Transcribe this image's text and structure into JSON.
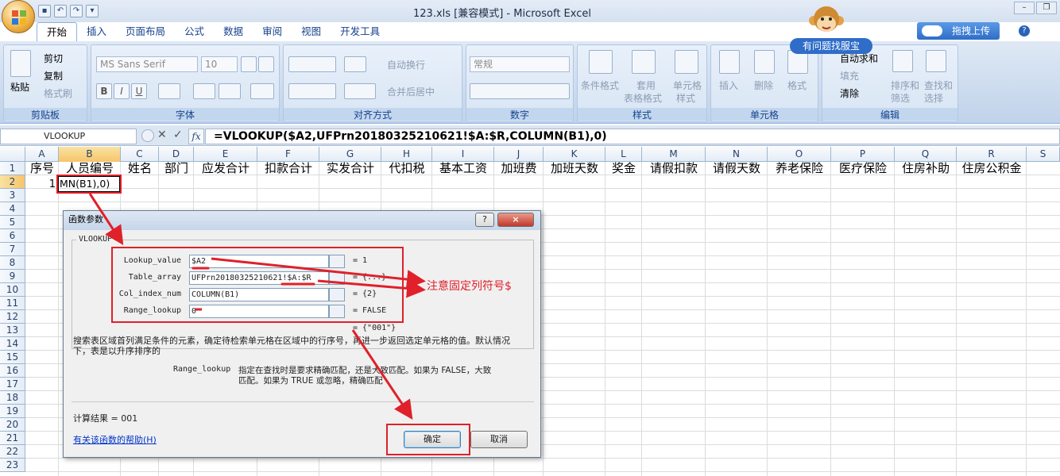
{
  "app": {
    "window_title": "123.xls  [兼容模式] - Microsoft Excel",
    "tabs": [
      "开始",
      "插入",
      "页面布局",
      "公式",
      "数据",
      "审阅",
      "视图",
      "开发工具"
    ],
    "assistant_badge": "有问题找服宝",
    "upload_button": "拖拽上传"
  },
  "ribbon": {
    "clipboard": {
      "paste": "粘贴",
      "cut": "剪切",
      "copy": "复制",
      "format_painter": "格式刷",
      "name": "剪贴板"
    },
    "font": {
      "family": "MS Sans Serif",
      "size": "10",
      "name": "字体"
    },
    "alignment": {
      "wrap": "自动换行",
      "merge": "合并后居中",
      "name": "对齐方式"
    },
    "number": {
      "format": "常规",
      "name": "数字"
    },
    "styles": {
      "conditional": "条件格式",
      "table_1": "套用",
      "table_2": "表格格式",
      "cell_1": "单元格",
      "cell_2": "样式",
      "name": "样式"
    },
    "cells": {
      "insert": "插入",
      "delete": "删除",
      "format": "格式",
      "name": "单元格"
    },
    "editing": {
      "autosum": "自动求和",
      "fill": "填充",
      "clear": "清除",
      "sort_1": "排序和",
      "sort_2": "筛选",
      "find_1": "查找和",
      "find_2": "选择",
      "name": "编辑"
    }
  },
  "formula_bar": {
    "name_box": "VLOOKUP",
    "fx": "fx",
    "formula": "=VLOOKUP($A2,UFPrn20180325210621!$A:$R,COLUMN(B1),0)"
  },
  "grid": {
    "columns": [
      "A",
      "B",
      "C",
      "D",
      "E",
      "F",
      "G",
      "H",
      "I",
      "J",
      "K",
      "L",
      "M",
      "N",
      "O",
      "P",
      "Q",
      "R",
      "S"
    ],
    "rows": [
      "1",
      "2",
      "3",
      "4",
      "5",
      "6",
      "7",
      "8",
      "9",
      "10",
      "11",
      "12",
      "13",
      "14",
      "15",
      "16",
      "17",
      "18",
      "19",
      "20",
      "21",
      "22",
      "23"
    ],
    "row1": [
      "序号",
      "人员编号",
      "姓名",
      "部门",
      "应发合计",
      "扣款合计",
      "实发合计",
      "代扣税",
      "基本工资",
      "加班费",
      "加班天数",
      "奖金",
      "请假扣款",
      "请假天数",
      "养老保险",
      "医疗保险",
      "住房补助",
      "住房公积金"
    ],
    "a2": "1",
    "b2": "MN(B1),0)"
  },
  "dialog": {
    "title": "函数参数",
    "help_q": "?",
    "close": "×",
    "function_name": "VLOOKUP",
    "args": [
      {
        "label": "Lookup_value",
        "value": "$A2",
        "result": "= 1"
      },
      {
        "label": "Table_array",
        "value": "UFPrn20180325210621!$A:$R",
        "result": "= {...}"
      },
      {
        "label": "Col_index_num",
        "value": "COLUMN(B1)",
        "result": "= {2}"
      },
      {
        "label": "Range_lookup",
        "value": "0",
        "result": "= FALSE"
      }
    ],
    "overall_result": "= {\"001\"}",
    "description": "搜索表区域首列满足条件的元素，确定待检索单元格在区域中的行序号，再进一步返回选定单元格的值。默认情况下，表是以升序排序的",
    "param_name": "Range_lookup",
    "param_desc_1": "指定在查找时是要求精确匹配，还是大致匹配。如果为 FALSE，大致",
    "param_desc_2": "匹配。如果为 TRUE 或忽略，精确匹配",
    "calc_result": "计算结果 =   001",
    "help_link": "有关该函数的帮助(H)",
    "ok": "确定",
    "cancel": "取消"
  },
  "annotation": {
    "note": "注意固定列符号$",
    "color": "#e0202a"
  }
}
